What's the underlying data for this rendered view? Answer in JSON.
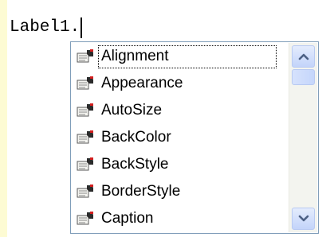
{
  "editor": {
    "code_text": "Label1."
  },
  "autocomplete": {
    "selected_index": 0,
    "items": [
      {
        "label": "Alignment",
        "icon": "property-icon"
      },
      {
        "label": "Appearance",
        "icon": "property-icon"
      },
      {
        "label": "AutoSize",
        "icon": "property-icon"
      },
      {
        "label": "BackColor",
        "icon": "property-icon"
      },
      {
        "label": "BackStyle",
        "icon": "property-icon"
      },
      {
        "label": "BorderStyle",
        "icon": "property-icon"
      },
      {
        "label": "Caption",
        "icon": "property-icon"
      }
    ]
  },
  "scrollbar": {
    "up_icon": "chevron-up-icon",
    "down_icon": "chevron-down-icon",
    "position_fraction": 0.0
  },
  "colors": {
    "margin": "#fdfbd3",
    "popup_border": "#7f9db9",
    "scroll_track": "#f3f4ef",
    "scroll_button": "#c3d4fa",
    "arrow": "#4d6185"
  }
}
